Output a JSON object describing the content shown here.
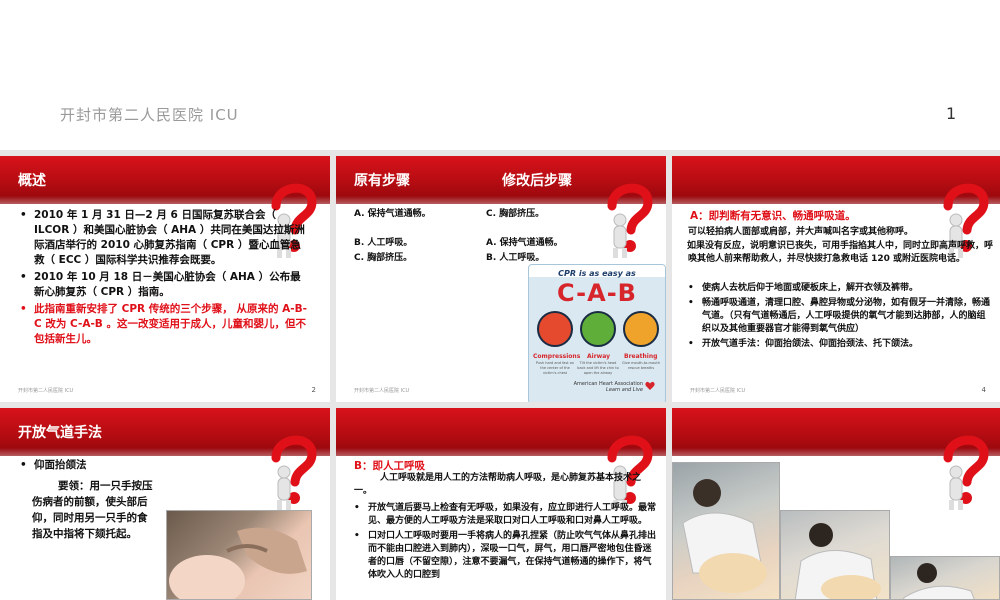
{
  "header": {
    "hospital": "开封市第二人民医院 ICU",
    "page_number": "1"
  },
  "slides": {
    "s1": {
      "title": "概述",
      "bullets": [
        "2010 年 1 月 31 日—2 月 6 日国际复苏联合会（ ILCOR ）和美国心脏协会（ AHA ）共同在美国达拉斯洲际酒店举行的 2010 心肺复苏指南（ CPR ）暨心血管急救（ ECC ）国际科学共识推荐会既要。",
        "2010 年 10 月 18 日－美国心脏协会（ AHA ）公布最新心肺复苏（ CPR ）指南。",
        "此指南重新安排了 CPR 传统的三个步骤， 从原来的 A-B-C 改为 C-A-B 。这一改变适用于成人，儿童和婴儿，但不包括新生儿。"
      ],
      "footer": "开封市第二人民医院 ICU",
      "num": "2"
    },
    "s2": {
      "title_left": "原有步骤",
      "title_right": "修改后步骤",
      "rows": [
        [
          "A. 保持气道通畅。",
          "C. 胸部挤压。"
        ],
        [
          "B. 人工呼吸。",
          "A. 保持气道通畅。"
        ],
        [
          "C. 胸部挤压。",
          "B. 人工呼吸。"
        ]
      ],
      "card": {
        "easy": "CPR is as easy as",
        "letters": "C-A-B",
        "labels": [
          "Compressions",
          "Airway",
          "Breathing"
        ],
        "descs": [
          "Push hard and fast on the center of the victim's chest",
          "Tilt the victim's head back and lift the chin to open the airway",
          "Give mouth-to-mouth rescue breaths"
        ],
        "org": "American Heart Association",
        "tagline": "Learn and Live"
      },
      "footer": "开封市第二人民医院 ICU"
    },
    "s3": {
      "heading": "A：即判断有无意识、畅通呼吸道。",
      "para1": "可以轻拍病人面部或肩部，并大声喊叫名字或其他称呼。",
      "para2": "如果没有反应，说明意识已丧失，可用手指掐其人中，同时立即高声呼救，呼唤其他人前来帮助救人，并尽快拨打急救电话 120 或附近医院电话。",
      "bullets": [
        "使病人去枕后仰于地面或硬板床上，解开衣领及裤带。",
        "畅通呼吸通道，清理口腔、鼻腔异物或分泌物，如有假牙一并清除，畅通气道。（只有气道畅通后，人工呼吸提供的氧气才能到达肺部，人的脑组织以及其他重要器官才能得到氧气供应）",
        "开放气道手法：仰面抬颌法、仰面抬颈法、托下颌法。"
      ],
      "footer": "开封市第二人民医院 ICU",
      "num": "4"
    },
    "s4": {
      "title": "开放气道手法",
      "bullet": "仰面抬颌法",
      "text": "要领：用一只手按压伤病者的前额，使头部后仰，同时用另一只手的食指及中指将下颏托起。"
    },
    "s5": {
      "heading": "B：即人工呼吸",
      "intro": "人工呼吸就是用人工的方法帮助病人呼吸，是心肺复苏基本技术之一。",
      "bullets": [
        "开放气道后要马上检查有无呼吸，如果没有，应立即进行人工呼吸。最常见、最方便的人工呼吸方法是采取口对口人工呼吸和口对鼻人工呼吸。",
        "口对口人工呼吸时要用一手将病人的鼻孔捏紧（防止吹气气体从鼻孔排出而不能由口腔进入到肺内），深吸一口气，屏气，用口唇严密地包住昏迷者的口唇（不留空隙），注意不要漏气，在保持气道畅通的操作下，将气体吹入人的口腔到"
      ]
    }
  },
  "colors": {
    "header_red": "#c20e15",
    "text_red": "#e01019",
    "page_grey": "#e6e6e6"
  }
}
